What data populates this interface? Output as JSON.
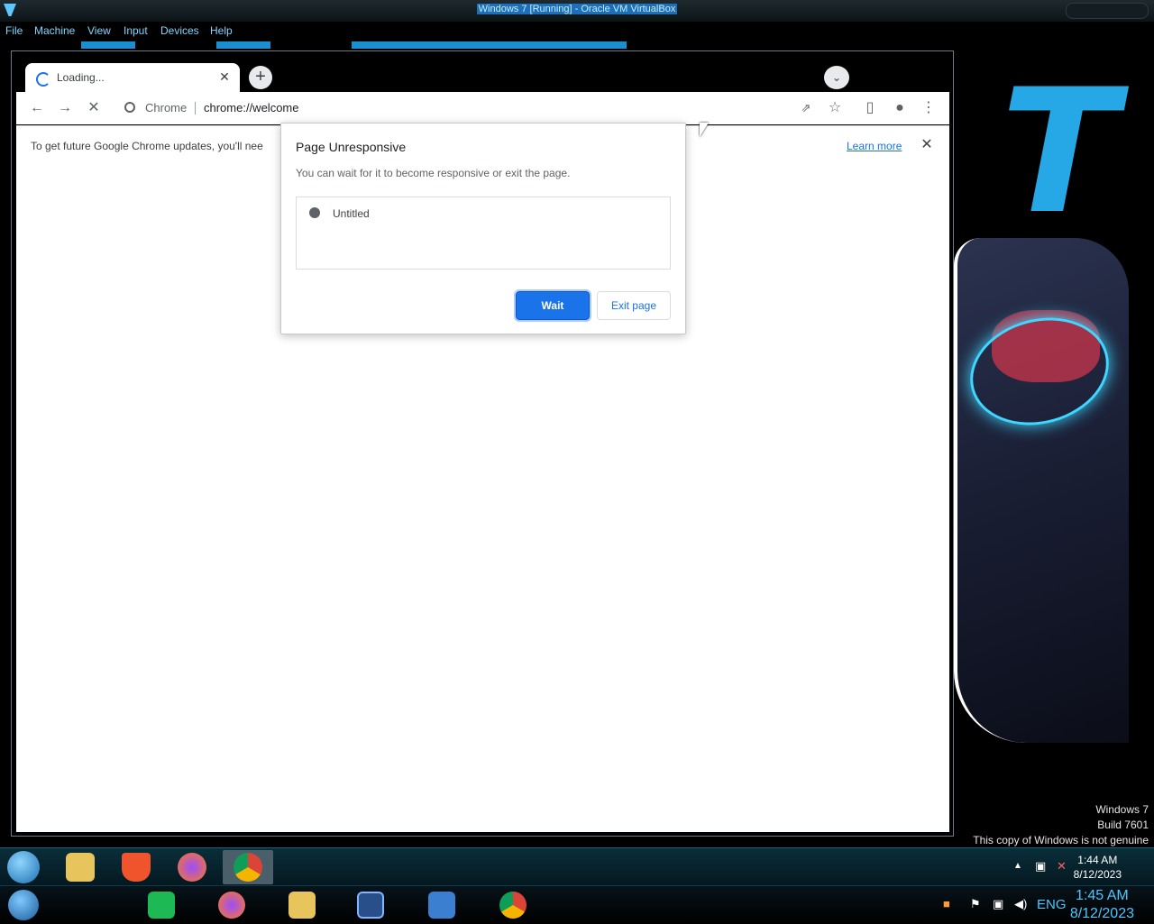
{
  "host": {
    "window_title": "Windows 7 [Running] - Oracle VM VirtualBox",
    "menu": [
      "File",
      "Machine",
      "View",
      "Input",
      "Devices",
      "Help"
    ],
    "taskbar": {
      "language": "ENG",
      "time": "1:45 AM",
      "date": "8/12/2023"
    }
  },
  "chrome": {
    "tab": {
      "title": "Loading...",
      "close_icon": "close-icon"
    },
    "omnibox": {
      "chip": "Chrome",
      "url": "chrome://welcome"
    },
    "infobar": {
      "text": "To get future Google Chrome updates, you'll nee",
      "link": "Learn more"
    }
  },
  "dialog": {
    "title": "Page Unresponsive",
    "message": "You can wait for it to become responsive or exit the page.",
    "items": [
      "Untitled"
    ],
    "wait_label": "Wait",
    "exit_label": "Exit page"
  },
  "guest": {
    "watermark": [
      "Windows 7",
      "Build 7601",
      "This copy of Windows is not genuine"
    ],
    "clock": {
      "time": "1:44 AM",
      "date": "8/12/2023"
    }
  },
  "colors": {
    "accent": "#1a73e8",
    "host_accent": "#48c8ff"
  }
}
